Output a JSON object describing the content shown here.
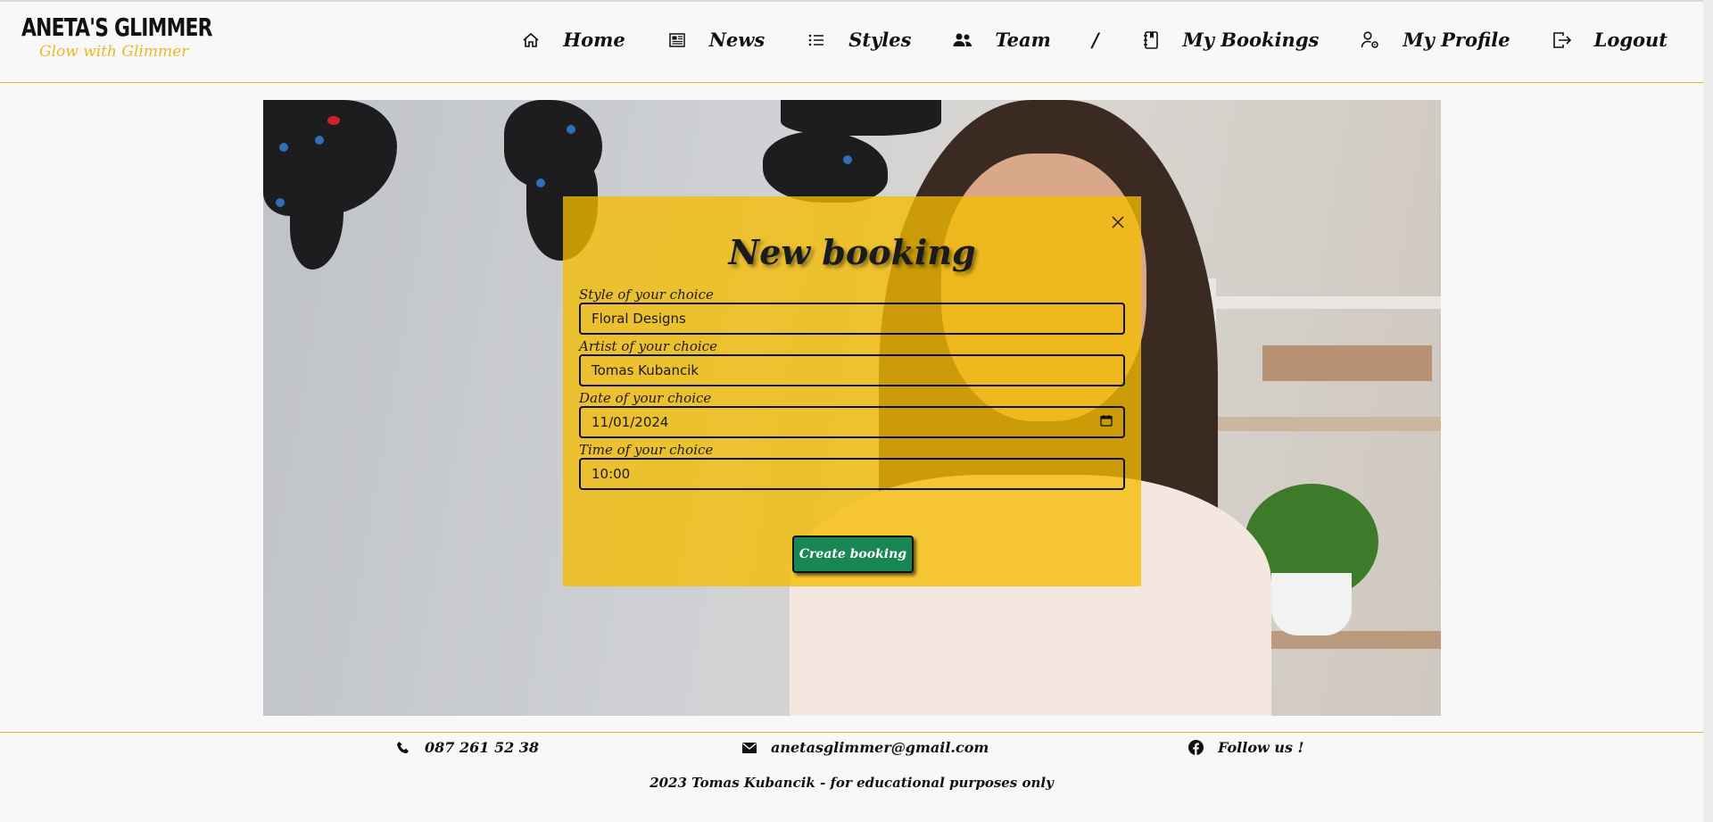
{
  "brand": {
    "title": "ANETA'S GLIMMER",
    "tagline": "Glow with Glimmer"
  },
  "nav": {
    "items": [
      {
        "label": "Home",
        "icon": "home-icon"
      },
      {
        "label": "News",
        "icon": "newspaper-icon"
      },
      {
        "label": "Styles",
        "icon": "list-icon"
      },
      {
        "label": "Team",
        "icon": "people-icon"
      },
      {
        "label": "My Bookings",
        "icon": "journal-icon"
      },
      {
        "label": "My Profile",
        "icon": "person-gear-icon"
      },
      {
        "label": "Logout",
        "icon": "logout-icon"
      }
    ],
    "separator": "/"
  },
  "modal": {
    "title": "New booking",
    "fields": {
      "style": {
        "label": "Style of your choice",
        "value": "Floral Designs"
      },
      "artist": {
        "label": "Artist of your choice",
        "value": "Tomas Kubancik"
      },
      "date": {
        "label": "Date of your choice",
        "value": "11/01/2024"
      },
      "time": {
        "label": "Time of your choice",
        "value": "10:00"
      }
    },
    "submit_label": "Create booking"
  },
  "footer": {
    "phone": "087 261 52 38",
    "email": "anetasglimmer@gmail.com",
    "social": "Follow us !",
    "copyright": "2023 Tomas Kubancik - for educational purposes only"
  },
  "colors": {
    "accent": "#e8b923",
    "modal_bg": "#f5bd00",
    "button": "#198754"
  }
}
